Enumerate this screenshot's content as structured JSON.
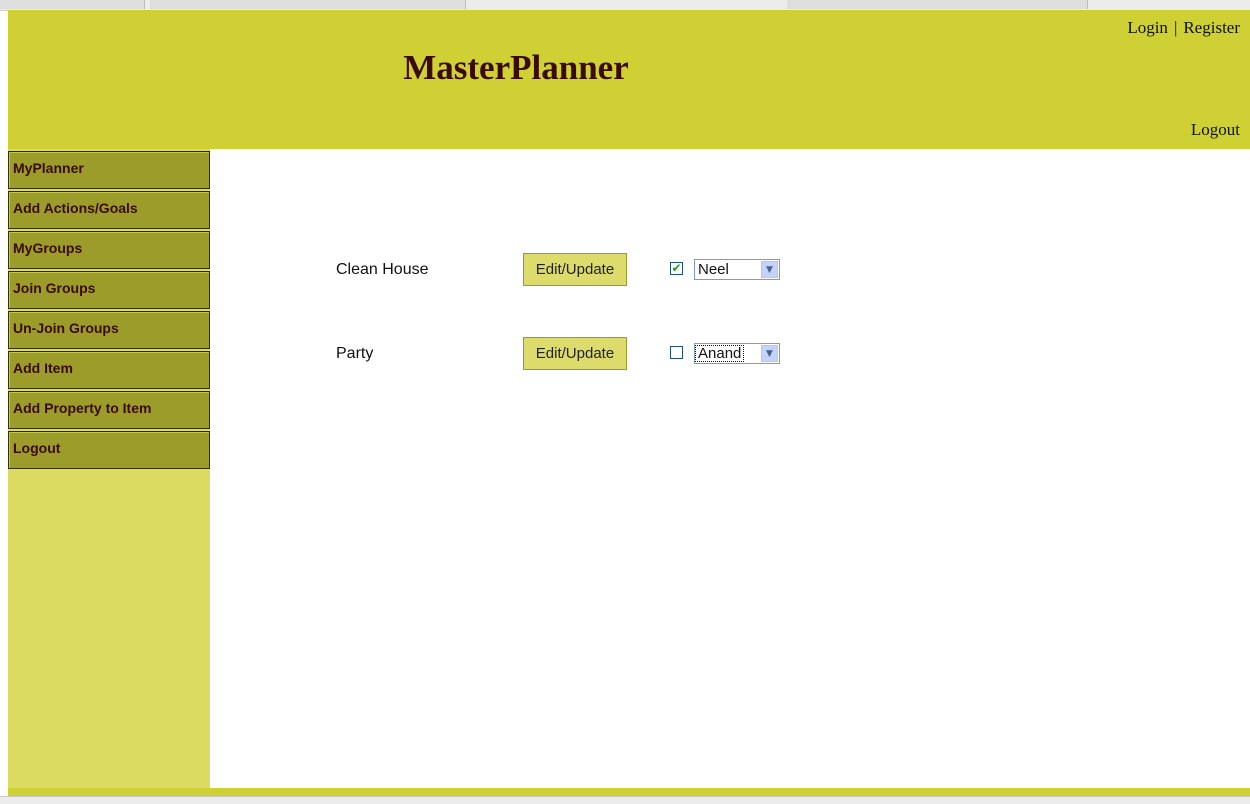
{
  "header": {
    "title": "MasterPlanner",
    "login": "Login",
    "separator": "|",
    "register": "Register",
    "logout": "Logout"
  },
  "sidebar": {
    "items": [
      {
        "label": "MyPlanner"
      },
      {
        "label": "Add Actions/Goals"
      },
      {
        "label": "MyGroups"
      },
      {
        "label": "Join Groups"
      },
      {
        "label": "Un-Join Groups"
      },
      {
        "label": "Add Item"
      },
      {
        "label": "Add Property to Item"
      },
      {
        "label": "Logout"
      }
    ]
  },
  "tasks": [
    {
      "name": "Clean House",
      "button": "Edit/Update",
      "checked": true,
      "checkmark": "✔",
      "assignee": "Neel"
    },
    {
      "name": "Party",
      "button": "Edit/Update",
      "checked": false,
      "checkmark": "",
      "assignee": "Anand"
    }
  ],
  "icons": {
    "dropdown": "chevron-down-icon",
    "checkbox": "checkbox-icon"
  },
  "colors": {
    "header_bg": "#cfd034",
    "sidebar_bg": "#dbdb62",
    "nav_item_bg": "#9c9c2a",
    "title_text": "#3a0a07",
    "button_bg": "#dcdb6c"
  }
}
